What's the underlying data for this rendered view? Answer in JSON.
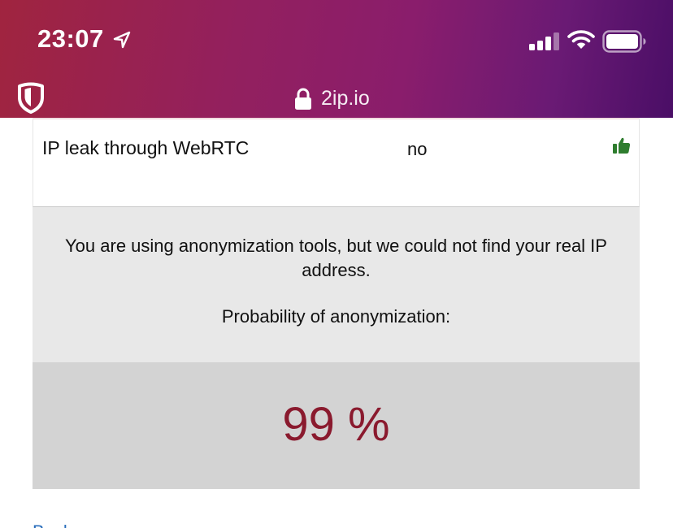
{
  "status_bar": {
    "time": "23:07"
  },
  "browser": {
    "address": "2ip.io"
  },
  "result_row": {
    "label": "IP leak through WebRTC",
    "value": "no"
  },
  "verdict": {
    "message": "You are using anonymization tools, but we could not find your real IP address.",
    "probability_label": "Probability of anonymization:",
    "probability_value": "99 %"
  },
  "footer": {
    "link_text": "Back"
  },
  "colors": {
    "header_gradient_start": "#a0243f",
    "header_gradient_end": "#4a0e66",
    "percentage_text": "#8a1a2e",
    "thumb_green": "#2e7d2e",
    "link_blue": "#2a6ebb"
  },
  "icons": [
    "location-arrow-icon",
    "cellular-signal-icon",
    "wifi-icon",
    "battery-icon",
    "shield-icon",
    "lock-icon",
    "thumbs-up-icon"
  ]
}
